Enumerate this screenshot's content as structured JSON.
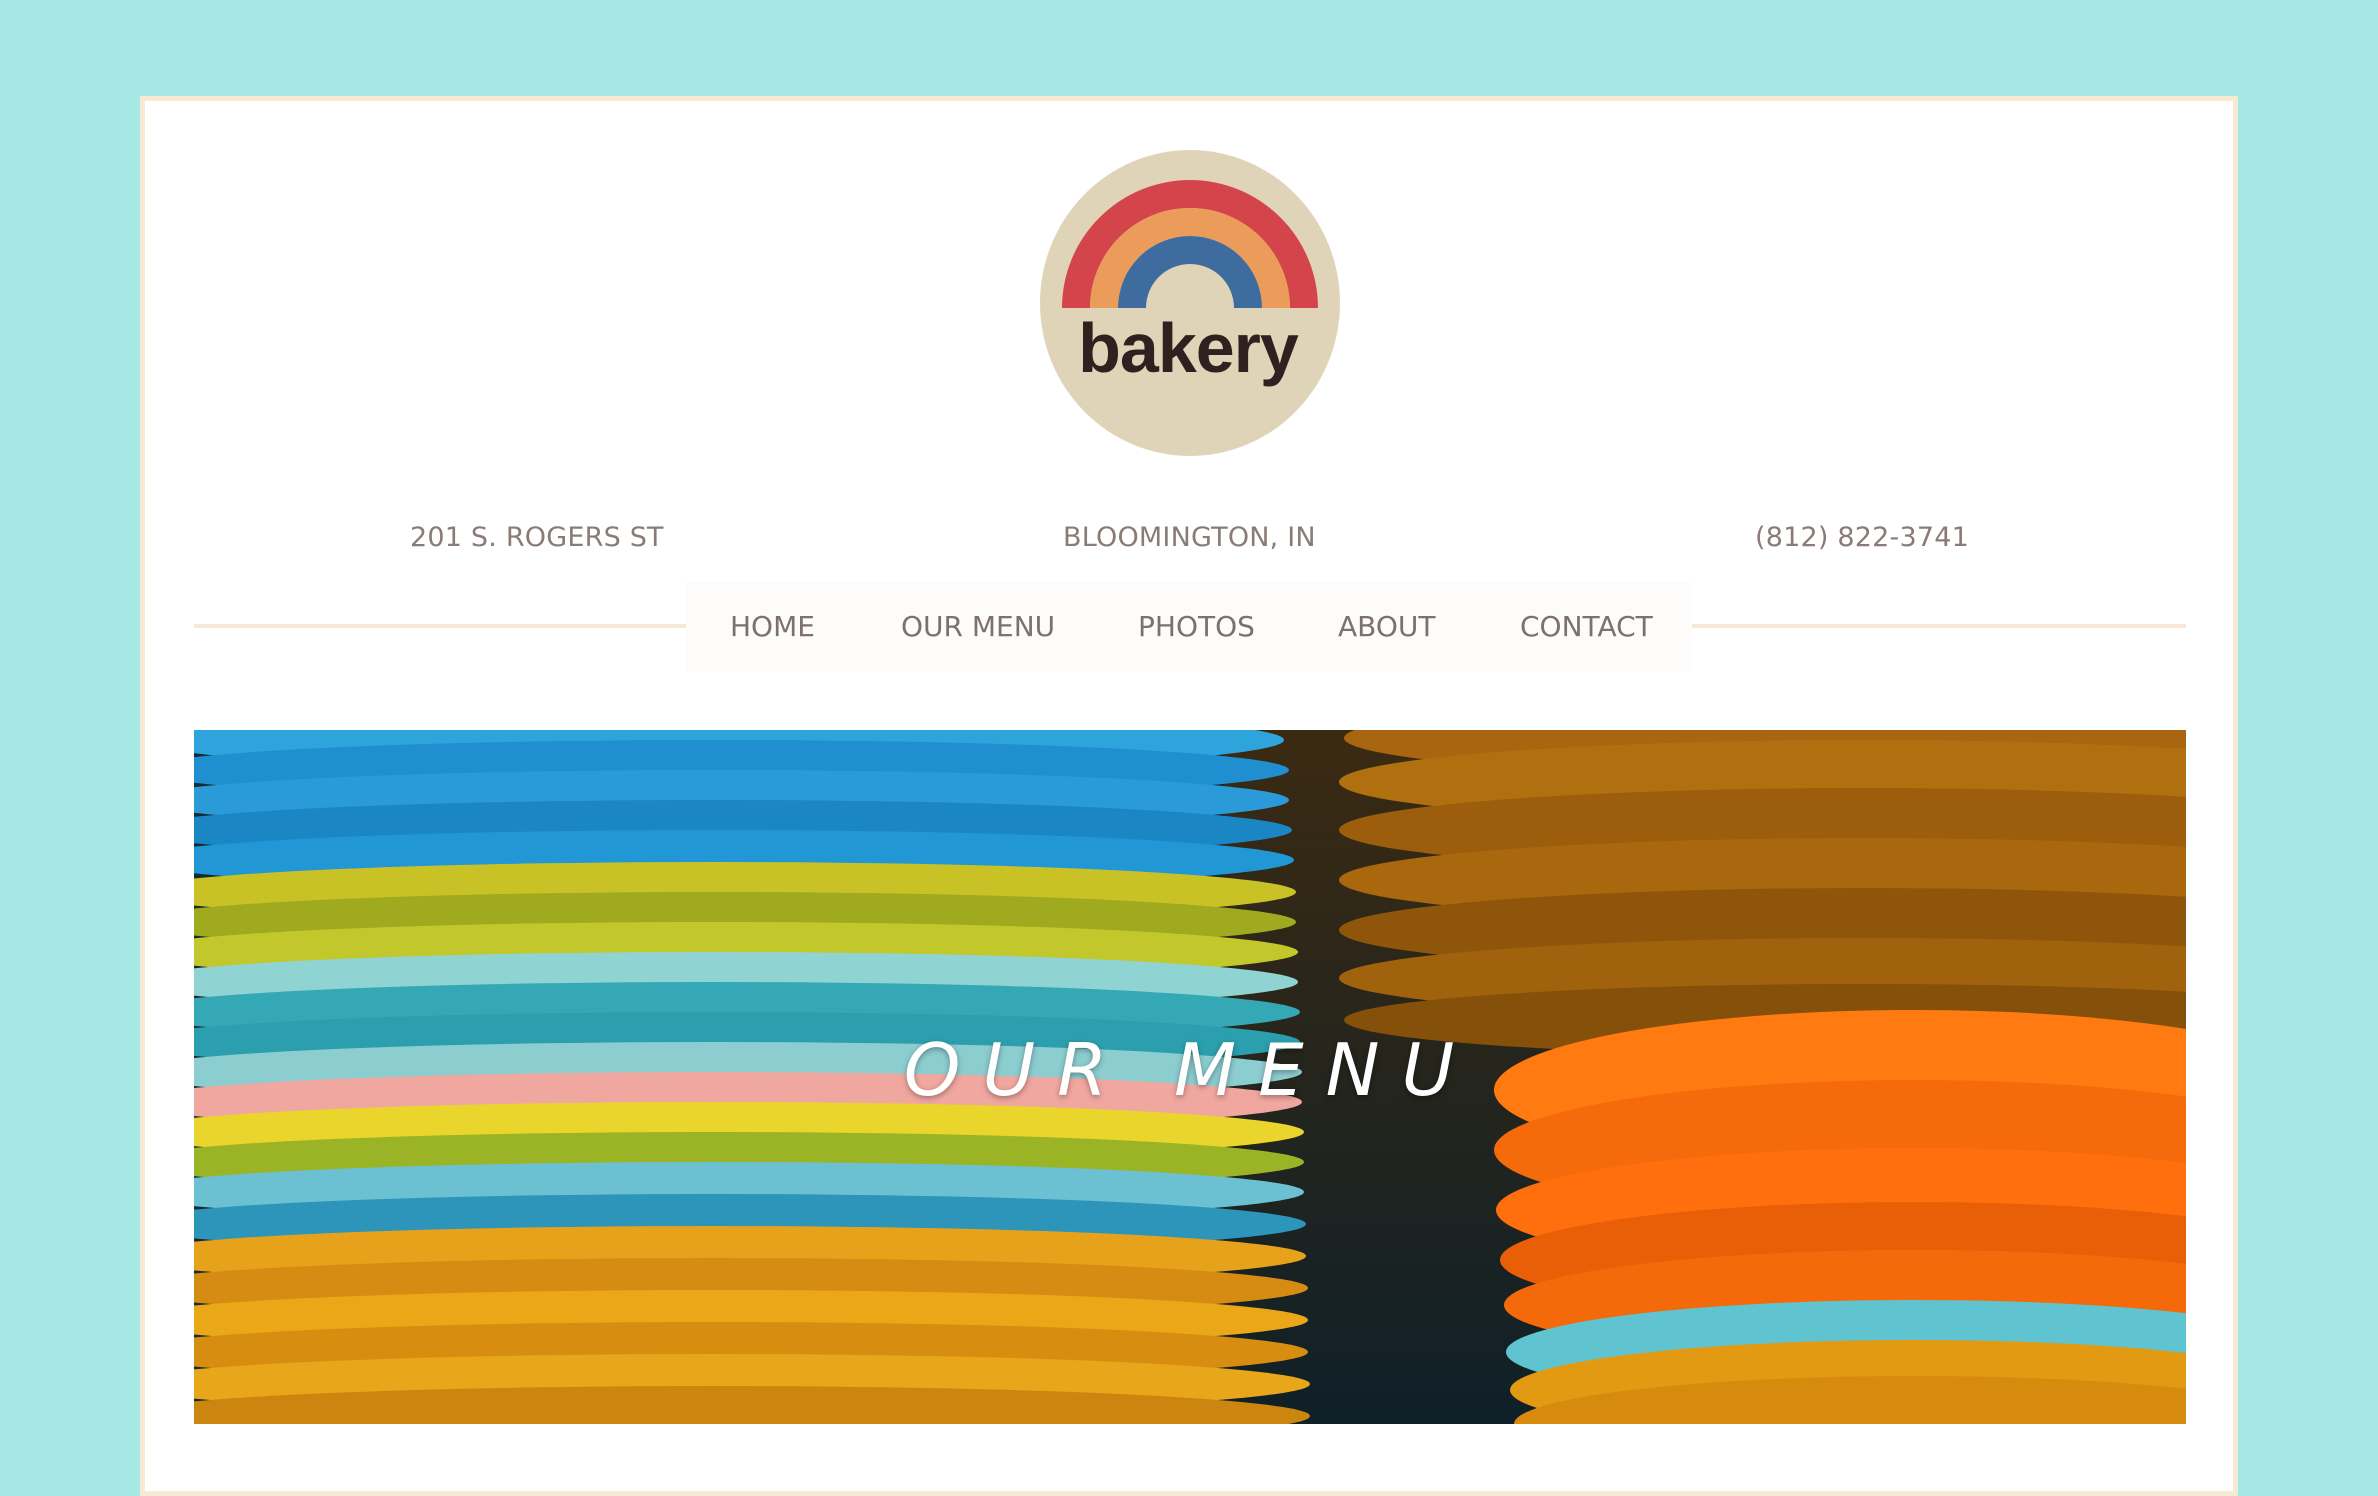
{
  "logo": {
    "text": "bakery"
  },
  "info": {
    "address": "201 S. ROGERS ST",
    "city": "BLOOMINGTON, IN",
    "phone": "(812) 822-3741"
  },
  "nav": {
    "items": [
      {
        "label": "HOME"
      },
      {
        "label": "OUR MENU"
      },
      {
        "label": "PHOTOS"
      },
      {
        "label": "ABOUT"
      },
      {
        "label": "CONTACT"
      }
    ]
  },
  "hero": {
    "title": "OUR MENU"
  },
  "colors": {
    "background": "#a6e8e4",
    "frame_border": "#f6ead3",
    "nav_text": "#7c716d",
    "logo_circle": "#e0d4b8",
    "rainbow_red": "#d4454b",
    "rainbow_orange": "#ec9c5a",
    "rainbow_blue": "#3f6c9e"
  }
}
